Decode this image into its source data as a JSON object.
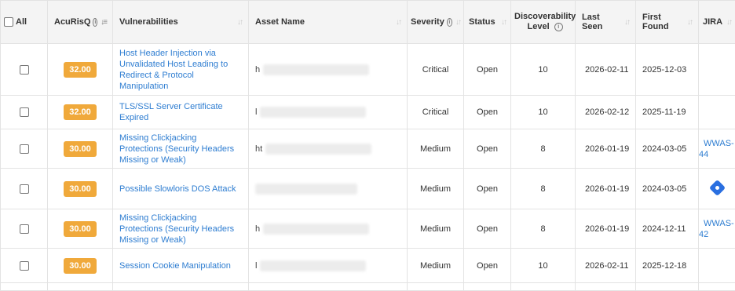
{
  "header": {
    "all": "All",
    "acurisq": "AcuRisQ",
    "vulnerabilities": "Vulnerabilities",
    "asset_name": "Asset Name",
    "severity": "Severity",
    "status": "Status",
    "discoverability_line1": "Discoverability",
    "discoverability_line2": "Level",
    "last_seen": "Last Seen",
    "first_found": "First Found",
    "jira": "JIRA"
  },
  "rows": [
    {
      "risk": "32.00",
      "vulnerability": "Host Header Injection via Unvalidated Host Leading to Redirect & Protocol Manipulation",
      "asset_prefix": "h",
      "severity": "Critical",
      "status": "Open",
      "level": "10",
      "last_seen": "2026-02-11",
      "first_found": "2025-12-03",
      "jira": ""
    },
    {
      "risk": "32.00",
      "vulnerability": "TLS/SSL Server Certificate Expired",
      "asset_prefix": "l",
      "severity": "Critical",
      "status": "Open",
      "level": "10",
      "last_seen": "2026-02-12",
      "first_found": "2025-11-19",
      "jira": ""
    },
    {
      "risk": "30.00",
      "vulnerability": "Missing Clickjacking Protections (Security Headers Missing or Weak)",
      "asset_prefix": "ht",
      "severity": "Medium",
      "status": "Open",
      "level": "8",
      "last_seen": "2026-01-19",
      "first_found": "2024-03-05",
      "jira": "WWAS-44"
    },
    {
      "risk": "30.00",
      "vulnerability": "Possible Slowloris DOS Attack",
      "asset_prefix": "",
      "severity": "Medium",
      "status": "Open",
      "level": "8",
      "last_seen": "2026-01-19",
      "first_found": "2024-03-05",
      "jira": "",
      "jira_icon": "jira-diamond-icon"
    },
    {
      "risk": "30.00",
      "vulnerability": "Missing Clickjacking Protections (Security Headers Missing or Weak)",
      "asset_prefix": "h",
      "severity": "Medium",
      "status": "Open",
      "level": "8",
      "last_seen": "2026-01-19",
      "first_found": "2024-12-11",
      "jira": "WWAS-42"
    },
    {
      "risk": "30.00",
      "vulnerability": "Session Cookie Manipulation",
      "asset_prefix": "l",
      "severity": "Medium",
      "status": "Open",
      "level": "10",
      "last_seen": "2026-02-11",
      "first_found": "2025-12-18",
      "jira": ""
    }
  ],
  "colors": {
    "risk_badge": "#f0a93b",
    "link": "#2e7dd1",
    "jira_icon": "#2a6fe0",
    "header_bg": "#f4f4f4"
  }
}
